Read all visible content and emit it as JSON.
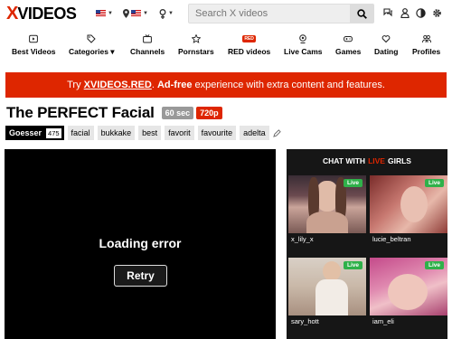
{
  "header": {
    "logo_x": "X",
    "logo_rest": "VIDEOS",
    "search_placeholder": "Search X videos",
    "colors": {
      "brand": "#de2600",
      "live": "#2fb14a"
    }
  },
  "nav": {
    "items": [
      {
        "label": "Best Videos",
        "icon": "play-square-icon"
      },
      {
        "label": "Categories ▾",
        "icon": "tags-icon"
      },
      {
        "label": "Channels",
        "icon": "tv-icon"
      },
      {
        "label": "Pornstars",
        "icon": "star-icon"
      },
      {
        "label": "RED videos",
        "icon": "red-badge-icon",
        "badge": "RED"
      },
      {
        "label": "Live Cams",
        "icon": "webcam-icon"
      },
      {
        "label": "Games",
        "icon": "gamepad-icon"
      },
      {
        "label": "Dating",
        "icon": "hearts-icon"
      },
      {
        "label": "Profiles",
        "icon": "profiles-icon"
      }
    ]
  },
  "banner": {
    "pre": "Try ",
    "link": "XVIDEOS.RED",
    "post_bold": "Ad-free",
    "post": " experience with extra content and features."
  },
  "video": {
    "title": "The PERFECT Facial",
    "duration": "60 sec",
    "quality": "720p",
    "uploader": "Goesser",
    "uploader_count": "475",
    "tags": [
      "facial",
      "bukkake",
      "best",
      "favorit",
      "favourite",
      "adelta"
    ]
  },
  "player": {
    "error": "Loading error",
    "retry": "Retry"
  },
  "chat": {
    "head_pre": "CHAT WITH",
    "head_live": "LIVE",
    "head_post": "GIRLS",
    "cams": [
      {
        "name": "x_lily_x",
        "badge": "Live"
      },
      {
        "name": "lucie_beltran",
        "badge": "Live"
      },
      {
        "name": "sary_hott",
        "badge": "Live"
      },
      {
        "name": "iam_eli",
        "badge": "Live"
      }
    ]
  }
}
